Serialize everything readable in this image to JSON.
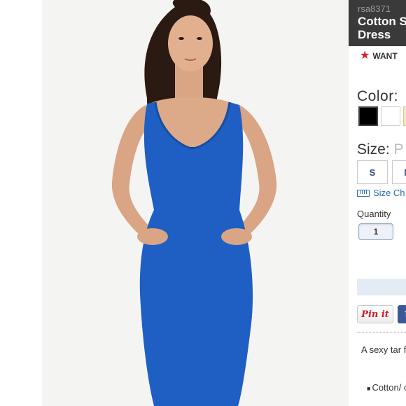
{
  "product": {
    "sku": "rsa8371",
    "title_line1": "Cotton S",
    "title_line2": "Dress"
  },
  "want": {
    "label": "WANT",
    "icon": "star-icon",
    "color": "#d0262b"
  },
  "color_section": {
    "label": "Color:",
    "swatches": [
      {
        "name": "black",
        "hex": "#000000"
      },
      {
        "name": "white",
        "hex": "#ffffff"
      },
      {
        "name": "cream",
        "hex": "#f3e6c4"
      }
    ]
  },
  "size_section": {
    "label": "Size:",
    "placeholder": "P",
    "options": [
      "S",
      "N"
    ],
    "size_chart_label": "Size Ch"
  },
  "quantity": {
    "label": "Quantity",
    "value": "1"
  },
  "share": {
    "pinterest_label": "Pin it",
    "facebook_label": "f"
  },
  "description": {
    "text": "A sexy tar fitting fabr",
    "bullet": "Cotton/ construct"
  },
  "colors": {
    "dress_blue": "#1f5fc4",
    "title_bg": "#3a3a3a",
    "link_blue": "#2a6fb3"
  }
}
